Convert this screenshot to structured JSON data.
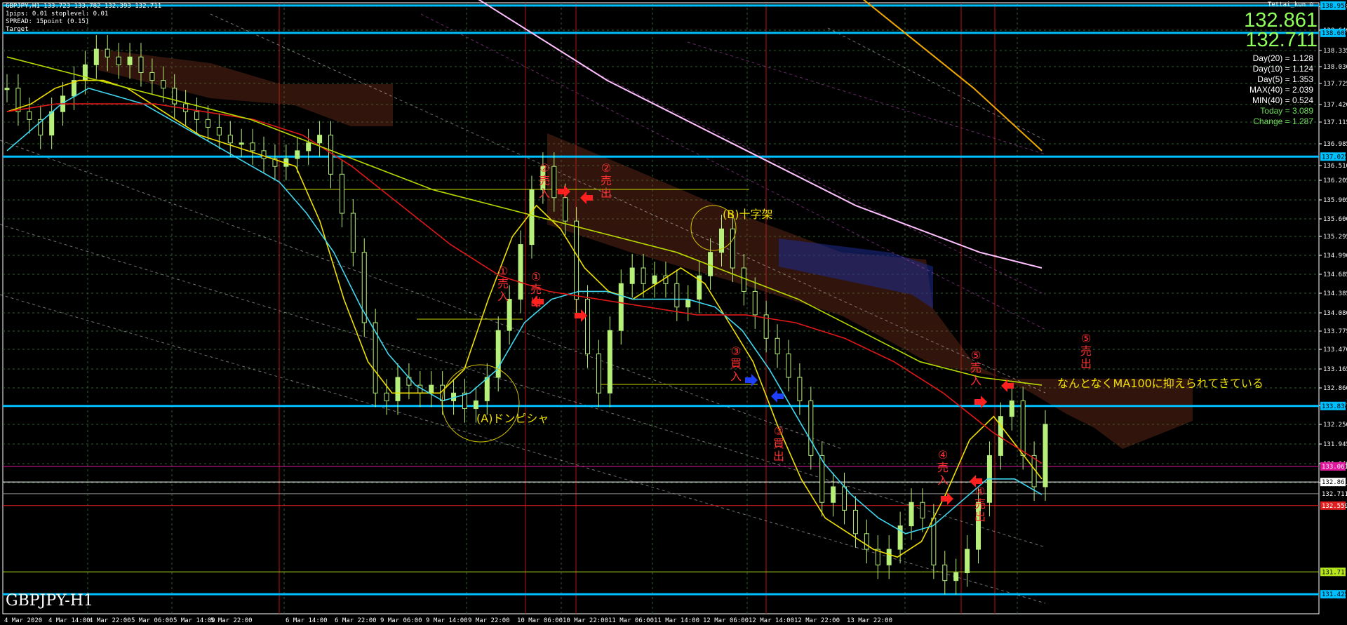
{
  "header": {
    "symbol_line": "GBPJPY,H1  133.723 133.782 132.393 132.711",
    "pips_line": "1pips: 0.01  stoplevel: 0.01",
    "spread_line": "SPREAD: 15point (0.15)",
    "target_line": "Target",
    "owner": "Tettai_kun"
  },
  "prices": {
    "bid": "132.861",
    "ask": "132.711"
  },
  "stats": [
    {
      "text": "Day(20) = 1.128",
      "color": "#ffffff"
    },
    {
      "text": "Day(10) = 1.124",
      "color": "#ffffff"
    },
    {
      "text": "Day(5) = 1.353",
      "color": "#ffffff"
    },
    {
      "text": "MAX(40) = 2.039",
      "color": "#ffffff"
    },
    {
      "text": "MIN(40) = 0.524",
      "color": "#ffffff"
    },
    {
      "text": "Today = 3.089",
      "color": "#6ee05a"
    },
    {
      "text": "Change = 1.287",
      "color": "#6ee05a"
    }
  ],
  "symbol_label": "GBPJPY-H1",
  "chart_data": {
    "type": "candlestick",
    "symbol": "GBPJPY",
    "timeframe": "H1",
    "ylim": [
      131.175,
      138.993
    ],
    "y_ticks": [
      "138.958",
      "138.640",
      "138.335",
      "138.030",
      "137.725",
      "137.420",
      "137.115",
      "136.985",
      "136.510",
      "136.205",
      "135.905",
      "135.600",
      "135.295",
      "134.990",
      "134.685",
      "134.385",
      "134.080",
      "133.775",
      "133.470",
      "133.165",
      "132.860",
      "132.555",
      "132.250",
      "131.945",
      "131.640",
      "131.345"
    ],
    "x_ticks": [
      "4 Mar 2020",
      "4 Mar 14:00",
      "4 Mar 22:00",
      "5 Mar 06:00",
      "5 Mar 14:00",
      "5 Mar 22:00",
      "6 Mar 14:00",
      "6 Mar 22:00",
      "9 Mar 06:00",
      "9 Mar 14:00",
      "9 Mar 22:00",
      "10 Mar 06:00",
      "10 Mar 22:00",
      "11 Mar 06:00",
      "11 Mar 14:00",
      "12 Mar 06:00",
      "12 Mar 14:00",
      "12 Mar 22:00",
      "13 Mar 22:00"
    ],
    "price_tags": [
      {
        "text": "138.958",
        "bg": "#00bfff",
        "fg": "#000000"
      },
      {
        "text": "138.608",
        "bg": "#00bfff",
        "fg": "#000000"
      },
      {
        "text": "137.025",
        "bg": "#00bfff",
        "fg": "#000000"
      },
      {
        "text": "133.834",
        "bg": "#00bfff",
        "fg": "#000000"
      },
      {
        "text": "133.061",
        "bg": "#e0189c",
        "fg": "#ffffff"
      },
      {
        "text": "132.861",
        "bg": "#ffffff",
        "fg": "#000000"
      },
      {
        "text": "132.711",
        "bg": "#000000",
        "fg": "#ffffff"
      },
      {
        "text": "132.559",
        "bg": "#e02020",
        "fg": "#ffffff"
      },
      {
        "text": "131.711",
        "bg": "#b6e61e",
        "fg": "#000000"
      },
      {
        "text": "131.425",
        "bg": "#00bfff",
        "fg": "#000000"
      }
    ],
    "horizontal_lines": [
      {
        "price": 138.958,
        "color": "#00bfff"
      },
      {
        "price": 138.608,
        "color": "#00bfff"
      },
      {
        "price": 137.025,
        "color": "#00bfff"
      },
      {
        "price": 133.834,
        "color": "#00bfff"
      },
      {
        "price": 133.061,
        "color": "#e0189c"
      },
      {
        "price": 132.861,
        "color": "#ffffff"
      },
      {
        "price": 132.711,
        "color": "#8a8a8a"
      },
      {
        "price": 132.559,
        "color": "#e02020"
      },
      {
        "price": 131.711,
        "color": "#b6e61e"
      },
      {
        "price": 131.425,
        "color": "#00bfff"
      }
    ],
    "series": [
      {
        "role": "candles",
        "color": "#b6f07a",
        "values": [
          137.9,
          137.6,
          137.5,
          137.3,
          137.6,
          137.8,
          138.0,
          138.2,
          138.4,
          138.3,
          138.2,
          138.3,
          138.1,
          138.0,
          137.9,
          137.7,
          137.6,
          137.5,
          137.4,
          137.3,
          137.2,
          137.2,
          137.1,
          137.0,
          136.9,
          137.0,
          137.1,
          137.2,
          137.3,
          136.8,
          136.3,
          135.8,
          134.9,
          134.0,
          133.9,
          134.2,
          134.1,
          134.0,
          134.1,
          133.9,
          134.0,
          133.8,
          133.9,
          134.2,
          134.8,
          135.2,
          135.9,
          136.6,
          136.9,
          136.5,
          136.2,
          135.2,
          134.5,
          134.0,
          134.8,
          135.4,
          135.6,
          135.4,
          135.5,
          135.4,
          135.1,
          135.2,
          135.5,
          135.8,
          136.1,
          135.6,
          135.3,
          135.0,
          134.7,
          134.5,
          134.2,
          133.9,
          133.2,
          132.6,
          132.8,
          132.5,
          132.2,
          132.0,
          131.8,
          132.0,
          132.3,
          132.6,
          132.4,
          131.8,
          131.6,
          131.7,
          132.0,
          132.6,
          133.2,
          133.7,
          133.9,
          133.2,
          132.8,
          133.6
        ]
      },
      {
        "role": "ma-yellow",
        "color": "#f0e000",
        "values": [
          137.6,
          137.7,
          137.9,
          138.0,
          138.0,
          137.9,
          137.7,
          137.5,
          137.3,
          137.2,
          137.1,
          137.0,
          136.9,
          136.2,
          135.2,
          134.4,
          134.0,
          134.0,
          134.0,
          134.3,
          135.2,
          136.0,
          136.4,
          136.1,
          135.6,
          135.3,
          135.2,
          135.4,
          135.6,
          135.4,
          134.9,
          134.4,
          133.6,
          132.9,
          132.4,
          132.2,
          132.0,
          131.9,
          132.1,
          132.7,
          133.4,
          133.7,
          133.3,
          132.9
        ]
      },
      {
        "role": "ma-cyan",
        "color": "#3fd8f0",
        "values": [
          137.1,
          137.4,
          137.7,
          137.9,
          137.8,
          137.7,
          137.5,
          137.3,
          137.1,
          136.9,
          136.7,
          136.3,
          135.8,
          135.1,
          134.5,
          134.1,
          133.9,
          134.0,
          134.3,
          134.9,
          135.2,
          135.3,
          135.3,
          135.2,
          135.2,
          135.2,
          135.1,
          134.8,
          134.3,
          133.7,
          133.1,
          132.7,
          132.4,
          132.2,
          132.3,
          132.6,
          132.9,
          132.9,
          132.7
        ]
      },
      {
        "role": "ma-red",
        "color": "#e01818",
        "values": [
          137.6,
          137.7,
          137.7,
          137.7,
          137.6,
          137.5,
          137.3,
          136.9,
          136.4,
          135.9,
          135.5,
          135.3,
          135.2,
          135.1,
          135.0,
          135.0,
          134.9,
          134.7,
          134.4,
          134.0,
          133.5,
          133.1
        ]
      },
      {
        "role": "ma-lime",
        "color": "#b8d800",
        "values": [
          138.3,
          138.1,
          137.9,
          137.7,
          137.5,
          137.2,
          136.9,
          136.6,
          136.4,
          136.2,
          136.0,
          135.8,
          135.5,
          135.2,
          134.8,
          134.4,
          134.2,
          134.1
        ]
      },
      {
        "role": "ma-pink",
        "color": "#ffc0ff",
        "values": [
          139.5,
          139.0,
          138.5,
          138.0,
          137.6,
          137.2,
          136.8,
          136.4,
          136.1,
          135.8,
          135.6
        ]
      },
      {
        "role": "ma-orange",
        "color": "#f0a800",
        "values": [
          140.5,
          139.9,
          139.3,
          138.6,
          137.9,
          137.1
        ]
      }
    ],
    "annotations": [
      {
        "text": "(A)ドンピシャ",
        "color": "#f0e000"
      },
      {
        "text": "(B)十字架",
        "color": "#f0e000"
      },
      {
        "text": "なんとなくMA100に抑えられてきている",
        "color": "#f0e000"
      },
      {
        "text": "①",
        "color": "#ff3030"
      },
      {
        "text": "売",
        "color": "#ff3030"
      },
      {
        "text": "入",
        "color": "#ff3030"
      },
      {
        "text": "①",
        "color": "#ff3030"
      },
      {
        "text": "売",
        "color": "#ff3030"
      },
      {
        "text": "出",
        "color": "#ff3030"
      },
      {
        "text": "②",
        "color": "#ff3030"
      },
      {
        "text": "売",
        "color": "#ff3030"
      },
      {
        "text": "入",
        "color": "#ff3030"
      },
      {
        "text": "②",
        "color": "#ff3030"
      },
      {
        "text": "売",
        "color": "#ff3030"
      },
      {
        "text": "出",
        "color": "#ff3030"
      },
      {
        "text": "③",
        "color": "#ff3030"
      },
      {
        "text": "買",
        "color": "#ff3030"
      },
      {
        "text": "入",
        "color": "#ff3030"
      },
      {
        "text": "③",
        "color": "#ff3030"
      },
      {
        "text": "買",
        "color": "#ff3030"
      },
      {
        "text": "出",
        "color": "#ff3030"
      },
      {
        "text": "④",
        "color": "#ff3030"
      },
      {
        "text": "売",
        "color": "#ff3030"
      },
      {
        "text": "入",
        "color": "#ff3030"
      },
      {
        "text": "④",
        "color": "#ff3030"
      },
      {
        "text": "売",
        "color": "#ff3030"
      },
      {
        "text": "出",
        "color": "#ff3030"
      },
      {
        "text": "⑤",
        "color": "#ff3030"
      },
      {
        "text": "売",
        "color": "#ff3030"
      },
      {
        "text": "入",
        "color": "#ff3030"
      },
      {
        "text": "⑤",
        "color": "#ff3030"
      },
      {
        "text": "売",
        "color": "#ff3030"
      },
      {
        "text": "出",
        "color": "#ff3030"
      }
    ]
  }
}
